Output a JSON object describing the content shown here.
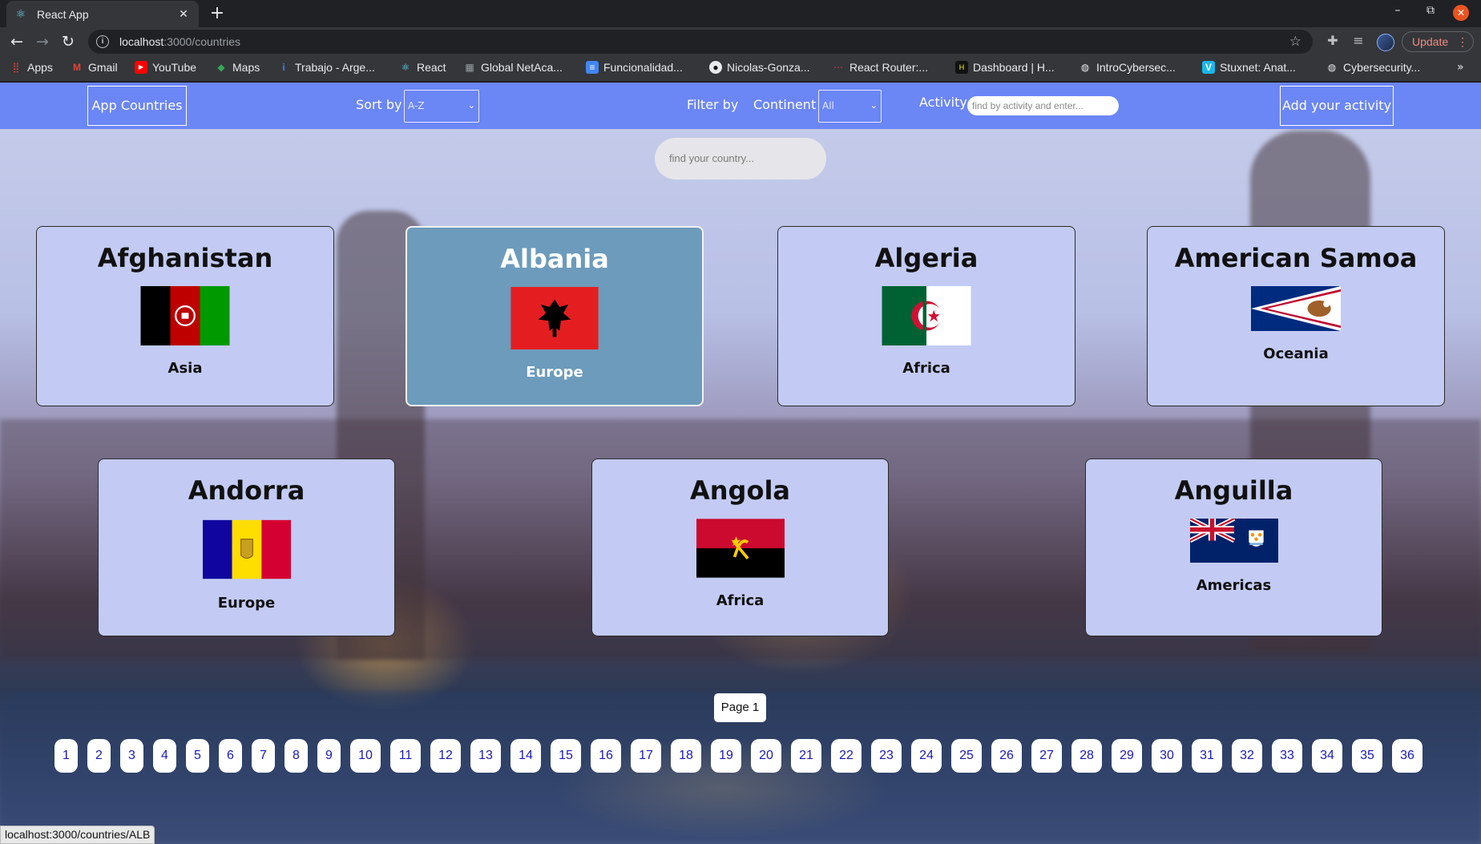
{
  "browser": {
    "tab_title": "React App",
    "url_host": "localhost",
    "url_path": ":3000/countries",
    "update_label": "Update",
    "bookmarks": [
      {
        "label": "Apps",
        "icon": "apps-grid-icon",
        "color": "#ea4335"
      },
      {
        "label": "Gmail",
        "icon": "gmail-icon",
        "color": "#ea4335"
      },
      {
        "label": "YouTube",
        "icon": "youtube-icon",
        "color": "#ff0000"
      },
      {
        "label": "Maps",
        "icon": "maps-icon",
        "color": "#34a853"
      },
      {
        "label": "Trabajo - Arge...",
        "icon": "info-icon",
        "color": "#4285f4"
      },
      {
        "label": "React",
        "icon": "react-icon",
        "color": "#61dafb"
      },
      {
        "label": "Global NetAca...",
        "icon": "netacad-icon",
        "color": "#9aa0a6"
      },
      {
        "label": "Funcionalidad...",
        "icon": "docs-icon",
        "color": "#4285f4"
      },
      {
        "label": "Nicolas-Gonza...",
        "icon": "github-icon",
        "color": "#202124"
      },
      {
        "label": "React Router:...",
        "icon": "react-router-icon",
        "color": "#ca4245"
      },
      {
        "label": "Dashboard | H...",
        "icon": "henry-icon",
        "color": "#111111"
      },
      {
        "label": "IntroCybersec...",
        "icon": "globe-icon",
        "color": "#e8eaed"
      },
      {
        "label": "Stuxnet: Anat...",
        "icon": "vimeo-icon",
        "color": "#1ab7ea"
      },
      {
        "label": "Cybersecurity...",
        "icon": "globe-icon",
        "color": "#e8eaed"
      }
    ],
    "status_url": "localhost:3000/countries/ALB"
  },
  "navbar": {
    "home_label": "App Countries",
    "sort_label": "Sort by",
    "sort_value": "A-Z",
    "filter_label": "Filter by",
    "continent_label": "Continent",
    "continent_value": "All",
    "activity_label": "Activity",
    "activity_placeholder": "find by activity and enter...",
    "add_label": "Add your activity",
    "color": "#6b86f5"
  },
  "search": {
    "placeholder": "find your country..."
  },
  "countries": [
    {
      "name": "Afghanistan",
      "continent": "Asia",
      "flag": "afghanistan-flag-icon"
    },
    {
      "name": "Albania",
      "continent": "Europe",
      "flag": "albania-flag-icon",
      "hovered": true
    },
    {
      "name": "Algeria",
      "continent": "Africa",
      "flag": "algeria-flag-icon"
    },
    {
      "name": "American Samoa",
      "continent": "Oceania",
      "flag": "american-samoa-flag-icon"
    },
    {
      "name": "Andorra",
      "continent": "Europe",
      "flag": "andorra-flag-icon"
    },
    {
      "name": "Angola",
      "continent": "Africa",
      "flag": "angola-flag-icon"
    },
    {
      "name": "Anguilla",
      "continent": "Americas",
      "flag": "anguilla-flag-icon"
    }
  ],
  "pagination": {
    "current_label": "Page 1",
    "pages": [
      "1",
      "2",
      "3",
      "4",
      "5",
      "6",
      "7",
      "8",
      "9",
      "10",
      "11",
      "12",
      "13",
      "14",
      "15",
      "16",
      "17",
      "18",
      "19",
      "20",
      "21",
      "22",
      "23",
      "24",
      "25",
      "26",
      "27",
      "28",
      "29",
      "30",
      "31",
      "32",
      "33",
      "34",
      "35",
      "36"
    ]
  }
}
